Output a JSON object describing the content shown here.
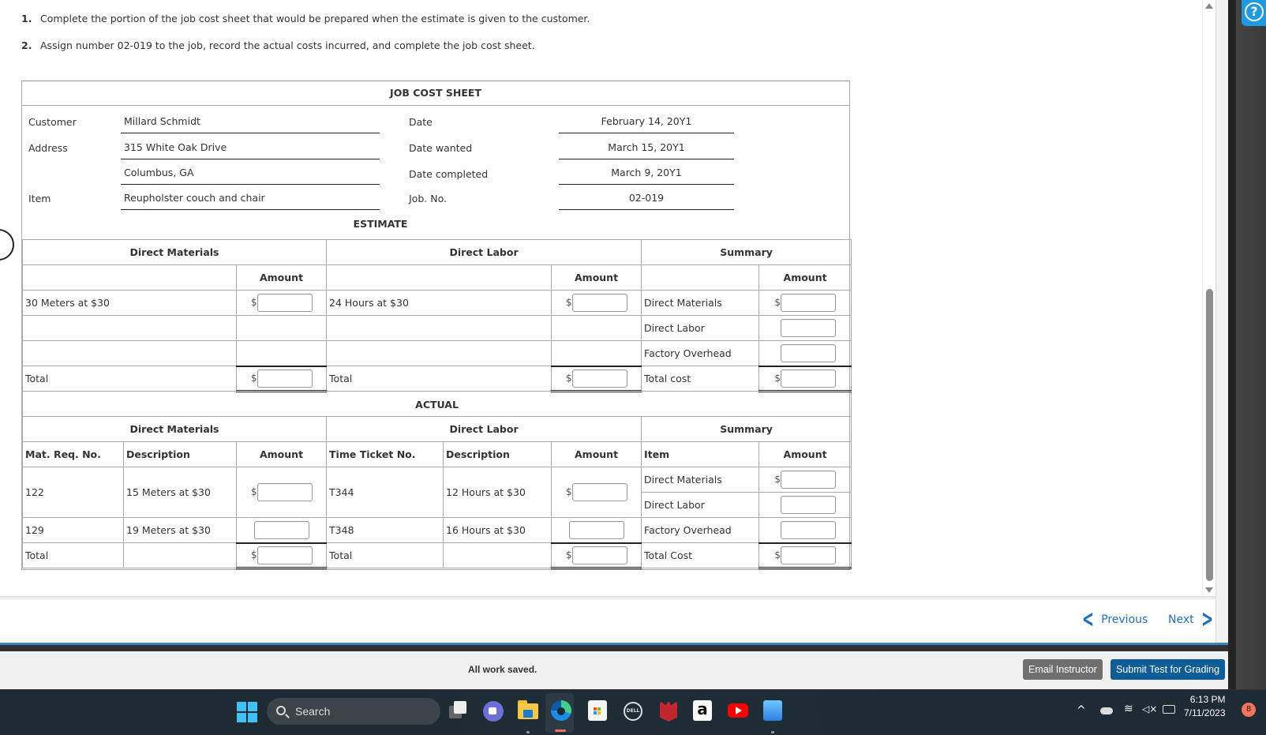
{
  "instructions": [
    {
      "num": "1.",
      "text": "Complete the portion of the job cost sheet that would be prepared when the estimate is given to the customer."
    },
    {
      "num": "2.",
      "text": "Assign number 02-019 to the job, record the actual costs incurred, and complete the job cost sheet."
    }
  ],
  "sheet": {
    "title": "JOB COST SHEET",
    "header": {
      "customer_label": "Customer",
      "customer": "Millard Schmidt",
      "address_label": "Address",
      "address_line1": "315 White Oak Drive",
      "address_line2": "Columbus, GA",
      "item_label": "Item",
      "item": "Reupholster couch and chair",
      "date_label": "Date",
      "date": "February 14, 20Y1",
      "date_wanted_label": "Date wanted",
      "date_wanted": "March 15, 20Y1",
      "date_completed_label": "Date completed",
      "date_completed": "March 9, 20Y1",
      "job_no_label": "Job. No.",
      "job_no": "02-019"
    },
    "estimate": {
      "title": "ESTIMATE",
      "dm_title": "Direct Materials",
      "dl_title": "Direct Labor",
      "summary_title": "Summary",
      "amount_label": "Amount",
      "dm_rows": [
        "30 Meters at $30",
        "",
        ""
      ],
      "dl_rows": [
        "24 Hours at $30",
        "",
        ""
      ],
      "summary_rows": [
        "Direct Materials",
        "Direct Labor",
        "Factory Overhead"
      ],
      "total_label": "Total",
      "total_cost_label": "Total cost",
      "currency": "$"
    },
    "actual": {
      "title": "ACTUAL",
      "dm_title": "Direct Materials",
      "dl_title": "Direct Labor",
      "summary_title": "Summary",
      "cols": {
        "mat_req": "Mat. Req. No.",
        "description": "Description",
        "amount": "Amount",
        "time_ticket": "Time Ticket No.",
        "item": "Item"
      },
      "dm_rows": [
        {
          "req": "122",
          "desc": "15 Meters at $30"
        },
        {
          "req": "129",
          "desc": "19 Meters at $30"
        }
      ],
      "dl_rows": [
        {
          "ticket": "T344",
          "desc": "12 Hours at $30"
        },
        {
          "ticket": "T348",
          "desc": "16 Hours at $30"
        }
      ],
      "summary_rows": [
        "Direct Materials",
        "Direct Labor",
        "Factory Overhead"
      ],
      "total_label": "Total",
      "total_cost_label": "Total Cost",
      "currency": "$"
    }
  },
  "nav": {
    "previous": "Previous",
    "next": "Next"
  },
  "footer": {
    "status": "All work saved.",
    "email_button": "Email Instructor",
    "submit_button": "Submit Test for Grading"
  },
  "help": {
    "glyph": "?"
  },
  "taskbar": {
    "search_placeholder": "Search",
    "time": "6:13 PM",
    "date": "7/11/2023",
    "notification_count": "8",
    "apps": [
      "task-view",
      "teams-meet",
      "file-explorer",
      "edge",
      "microsoft-store",
      "dell",
      "mcafee",
      "amazon",
      "youtube",
      "photos"
    ]
  },
  "colors": {
    "link_blue": "#1a6fc4",
    "submit_blue": "#0e5d99",
    "email_gray": "#6f6f6f",
    "help_blue": "#1e9be0"
  }
}
